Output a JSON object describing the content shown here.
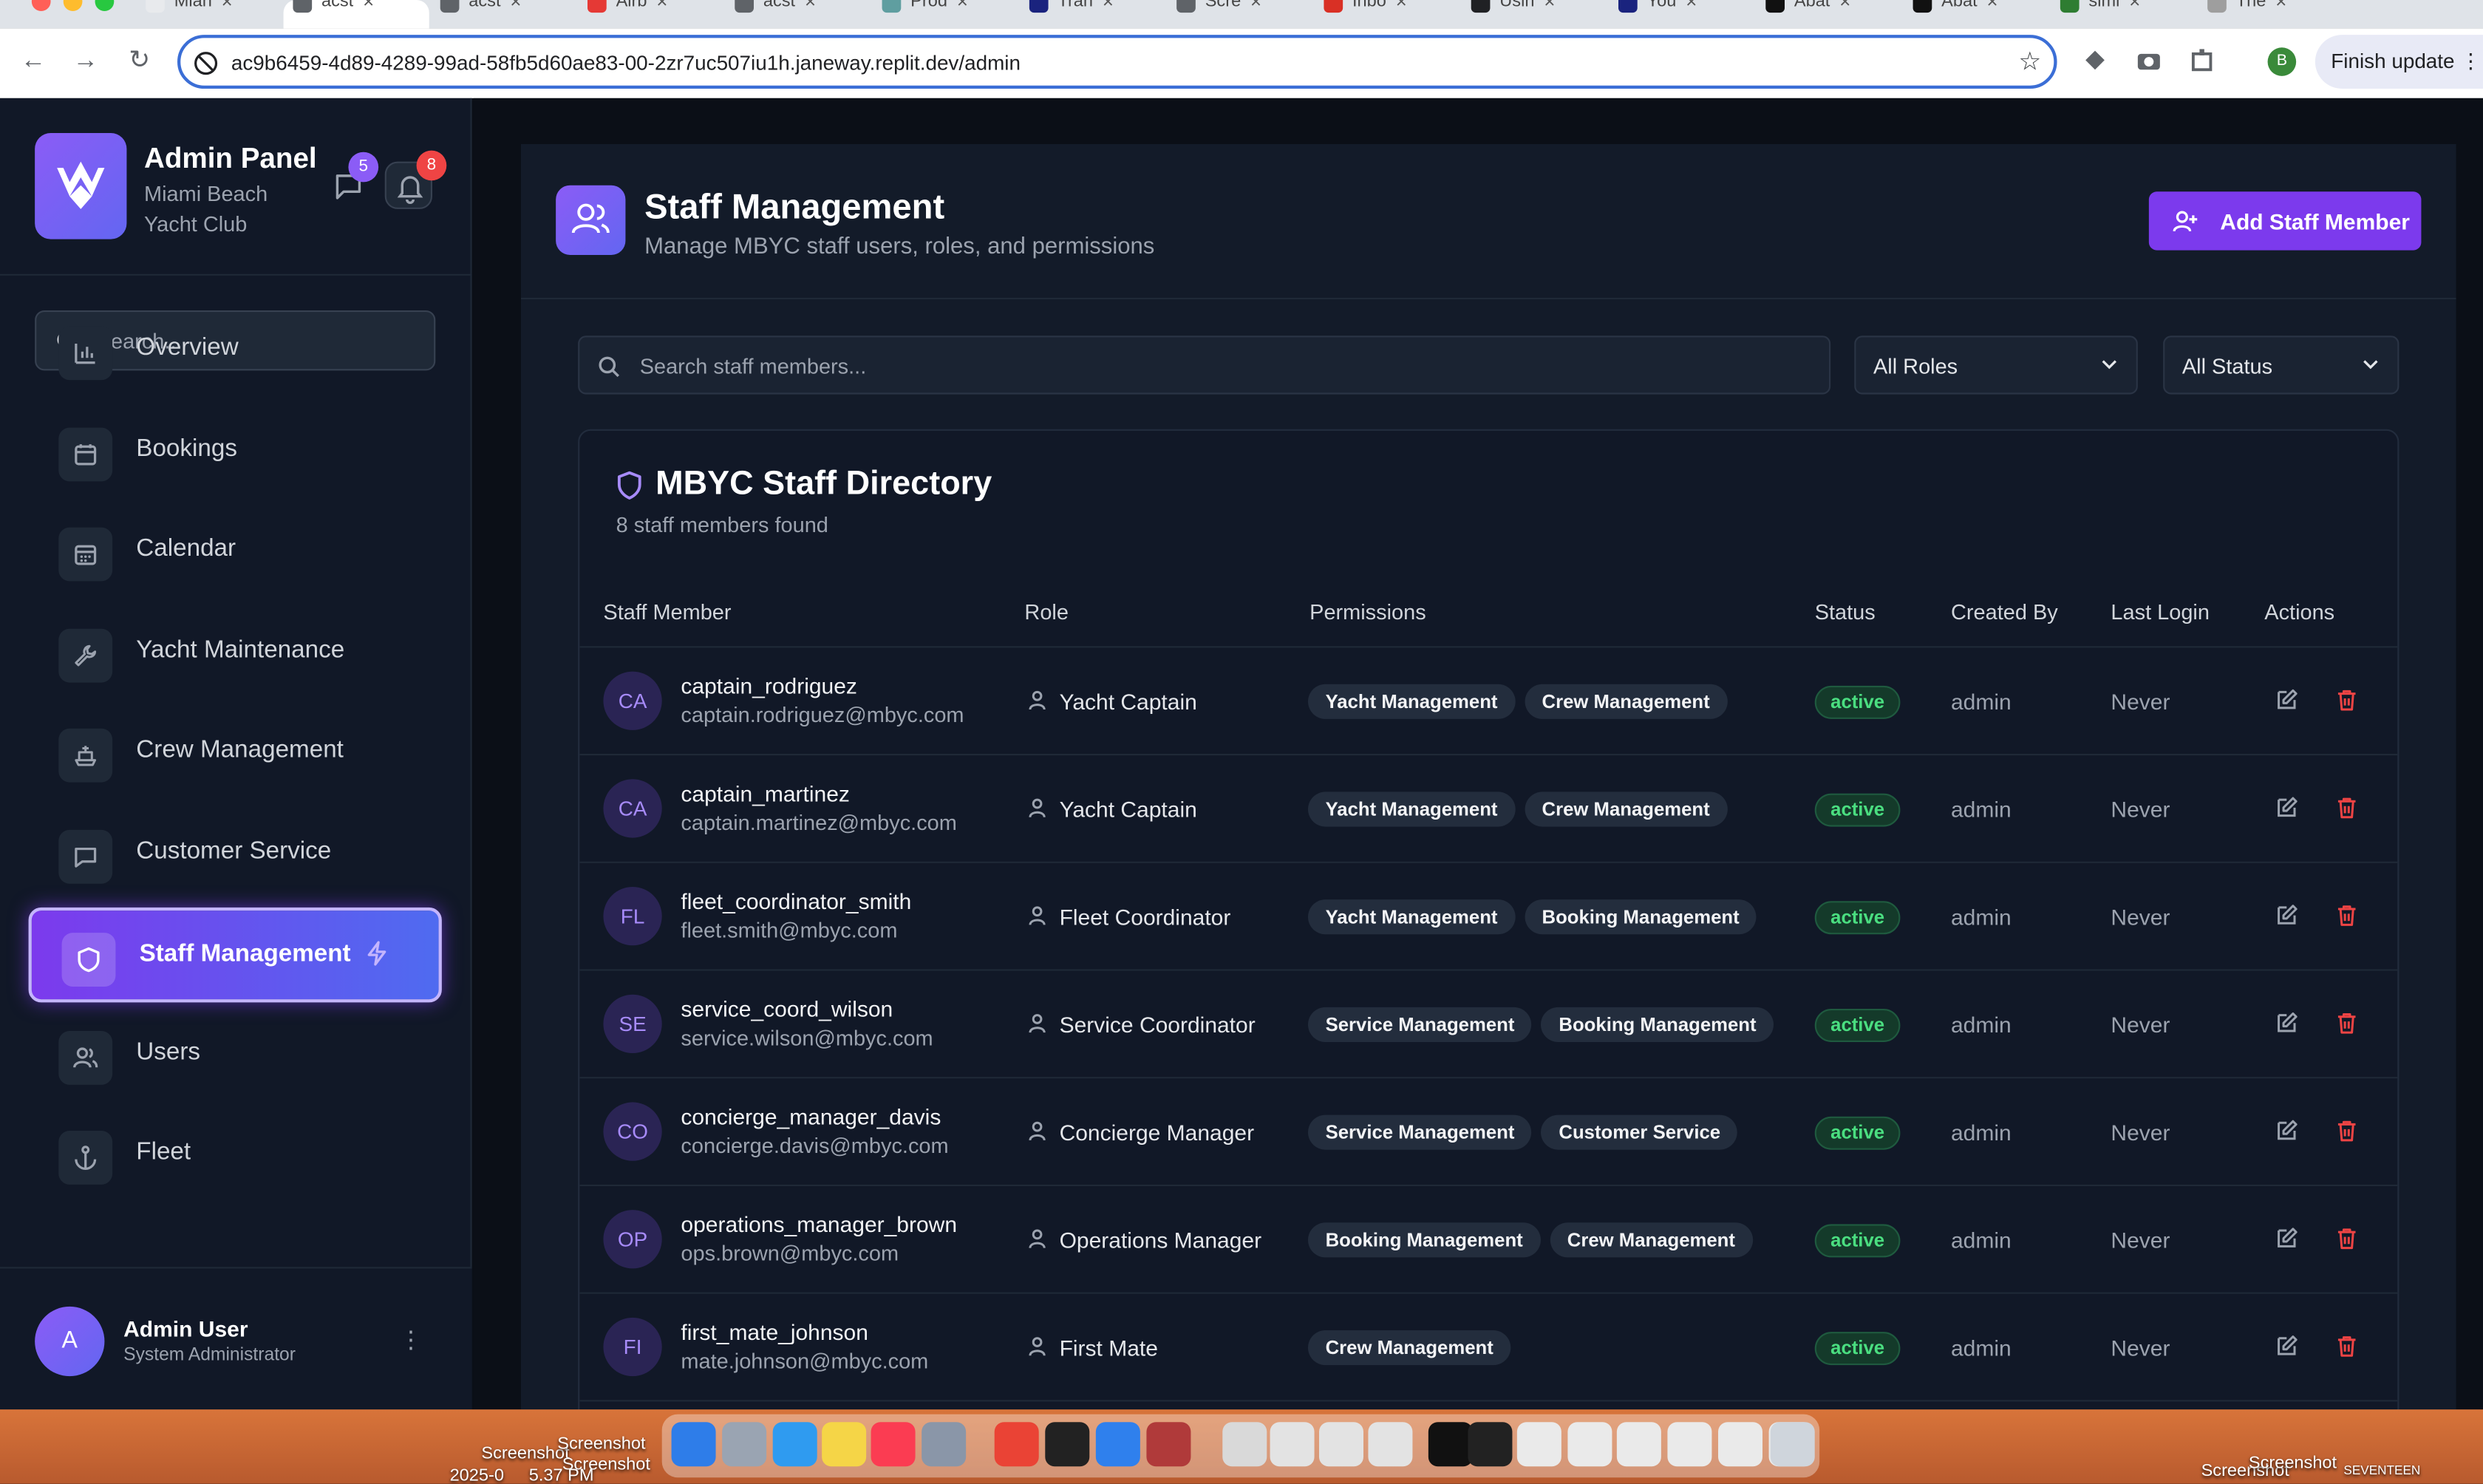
{
  "browser": {
    "url": "ac9b6459-4d89-4289-99ad-58fb5d60ae83-00-2zr7uc507iu1h.janeway.replit.dev/admin",
    "profile_initial": "B",
    "finish_update_label": "Finish update",
    "tabs": [
      "Mian",
      "acst",
      "acst",
      "Airb",
      "acst",
      "Prod",
      "Tran",
      "Scre",
      "Inbo",
      "Usin",
      "You",
      "Abat",
      "Abat",
      "simi",
      "The"
    ]
  },
  "sidebar": {
    "title": "Admin Panel",
    "subtitle": "Miami Beach Yacht Club",
    "messages_badge": "5",
    "notifications_badge": "8",
    "search_placeholder": "Search...",
    "items": [
      {
        "label": "Overview",
        "icon": "bar-chart-icon"
      },
      {
        "label": "Bookings",
        "icon": "calendar-icon"
      },
      {
        "label": "Calendar",
        "icon": "calendar-grid-icon"
      },
      {
        "label": "Yacht Maintenance",
        "icon": "wrench-icon"
      },
      {
        "label": "Crew Management",
        "icon": "ship-icon"
      },
      {
        "label": "Customer Service",
        "icon": "message-square-icon"
      },
      {
        "label": "Staff Management",
        "icon": "shield-icon",
        "active": true
      },
      {
        "label": "Users",
        "icon": "users-icon"
      },
      {
        "label": "Fleet",
        "icon": "anchor-icon"
      }
    ],
    "user": {
      "initial": "A",
      "name": "Admin User",
      "role": "System Administrator"
    }
  },
  "page": {
    "title": "Staff Management",
    "subtitle": "Manage MBYC staff users, roles, and permissions",
    "add_button": "Add Staff Member",
    "search_placeholder": "Search staff members...",
    "role_filter": "All Roles",
    "status_filter": "All Status"
  },
  "directory": {
    "title": "MBYC Staff Directory",
    "count_text": "8 staff members found",
    "columns": [
      "Staff Member",
      "Role",
      "Permissions",
      "Status",
      "Created By",
      "Last Login",
      "Actions"
    ],
    "rows": [
      {
        "initials": "CA",
        "username": "captain_rodriguez",
        "email": "captain.rodriguez@mbyc.com",
        "role": "Yacht Captain",
        "permissions": [
          "Yacht Management",
          "Crew Management"
        ],
        "status": "active",
        "created_by": "admin",
        "last_login": "Never"
      },
      {
        "initials": "CA",
        "username": "captain_martinez",
        "email": "captain.martinez@mbyc.com",
        "role": "Yacht Captain",
        "permissions": [
          "Yacht Management",
          "Crew Management"
        ],
        "status": "active",
        "created_by": "admin",
        "last_login": "Never"
      },
      {
        "initials": "FL",
        "username": "fleet_coordinator_smith",
        "email": "fleet.smith@mbyc.com",
        "role": "Fleet Coordinator",
        "permissions": [
          "Yacht Management",
          "Booking Management"
        ],
        "status": "active",
        "created_by": "admin",
        "last_login": "Never"
      },
      {
        "initials": "SE",
        "username": "service_coord_wilson",
        "email": "service.wilson@mbyc.com",
        "role": "Service Coordinator",
        "permissions": [
          "Service Management",
          "Booking Management"
        ],
        "status": "active",
        "created_by": "admin",
        "last_login": "Never"
      },
      {
        "initials": "CO",
        "username": "concierge_manager_davis",
        "email": "concierge.davis@mbyc.com",
        "role": "Concierge Manager",
        "permissions": [
          "Service Management",
          "Customer Service"
        ],
        "status": "active",
        "created_by": "admin",
        "last_login": "Never"
      },
      {
        "initials": "OP",
        "username": "operations_manager_brown",
        "email": "ops.brown@mbyc.com",
        "role": "Operations Manager",
        "permissions": [
          "Booking Management",
          "Crew Management"
        ],
        "status": "active",
        "created_by": "admin",
        "last_login": "Never"
      },
      {
        "initials": "FI",
        "username": "first_mate_johnson",
        "email": "mate.johnson@mbyc.com",
        "role": "First Mate",
        "permissions": [
          "Crew Management"
        ],
        "status": "active",
        "created_by": "admin",
        "last_login": "Never"
      }
    ]
  },
  "desktop": {
    "labels": [
      "Screenshot",
      "Screenshot",
      "Screenshot",
      "2025-0",
      "5.37 PM",
      "Screenshot",
      "Screenshot",
      "SEVENTEEN"
    ]
  },
  "colors": {
    "accent": "#7c3aed",
    "sidebar_bg": "#111827",
    "panel_bg": "#131b29",
    "status_green": "#4ade80",
    "delete_red": "#ef4444"
  }
}
